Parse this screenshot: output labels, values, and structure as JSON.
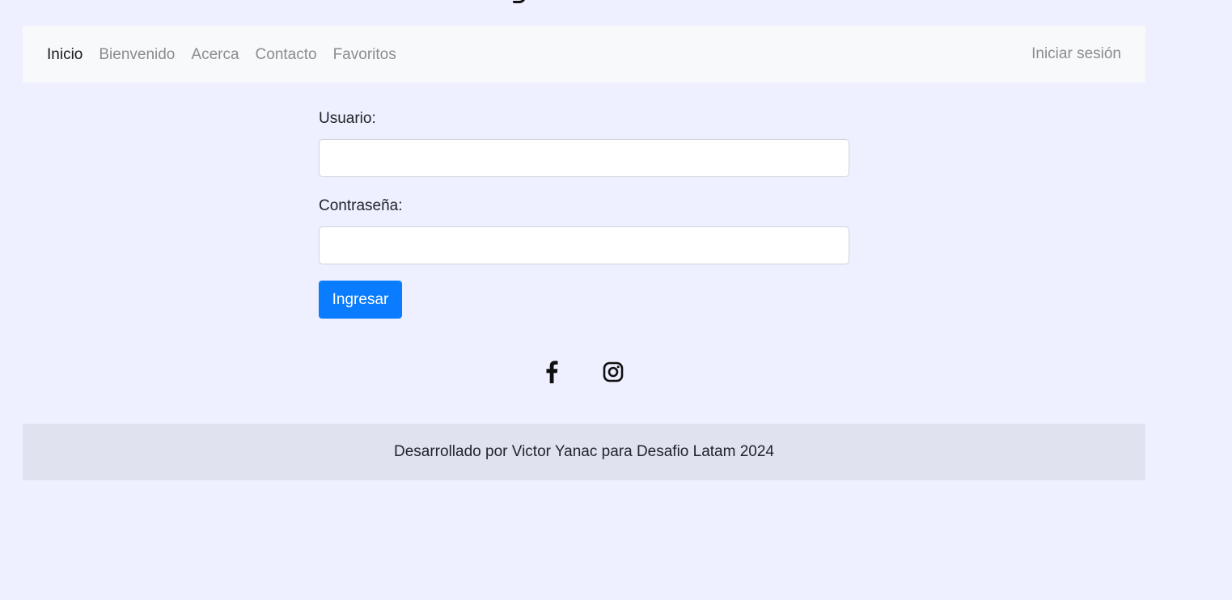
{
  "nav": {
    "items": [
      {
        "label": "Inicio",
        "active": true
      },
      {
        "label": "Bienvenido",
        "active": false
      },
      {
        "label": "Acerca",
        "active": false
      },
      {
        "label": "Contacto",
        "active": false
      },
      {
        "label": "Favoritos",
        "active": false
      }
    ],
    "login_label": "Iniciar sesión"
  },
  "form": {
    "user_label": "Usuario:",
    "user_value": "",
    "password_label": "Contraseña:",
    "password_value": "",
    "submit_label": "Ingresar"
  },
  "social": {
    "icons": [
      "facebook-icon",
      "instagram-icon"
    ]
  },
  "footer": {
    "text": "Desarrollado por Victor Yanac para Desafio Latam 2024"
  },
  "colors": {
    "page_background": "#eeefff",
    "navbar_background": "#f8f9fa",
    "footer_background": "#e0e2f0",
    "primary_button": "#0a7cff",
    "nav_inactive": "#8a8c8f",
    "nav_active": "#1a1a1a"
  }
}
